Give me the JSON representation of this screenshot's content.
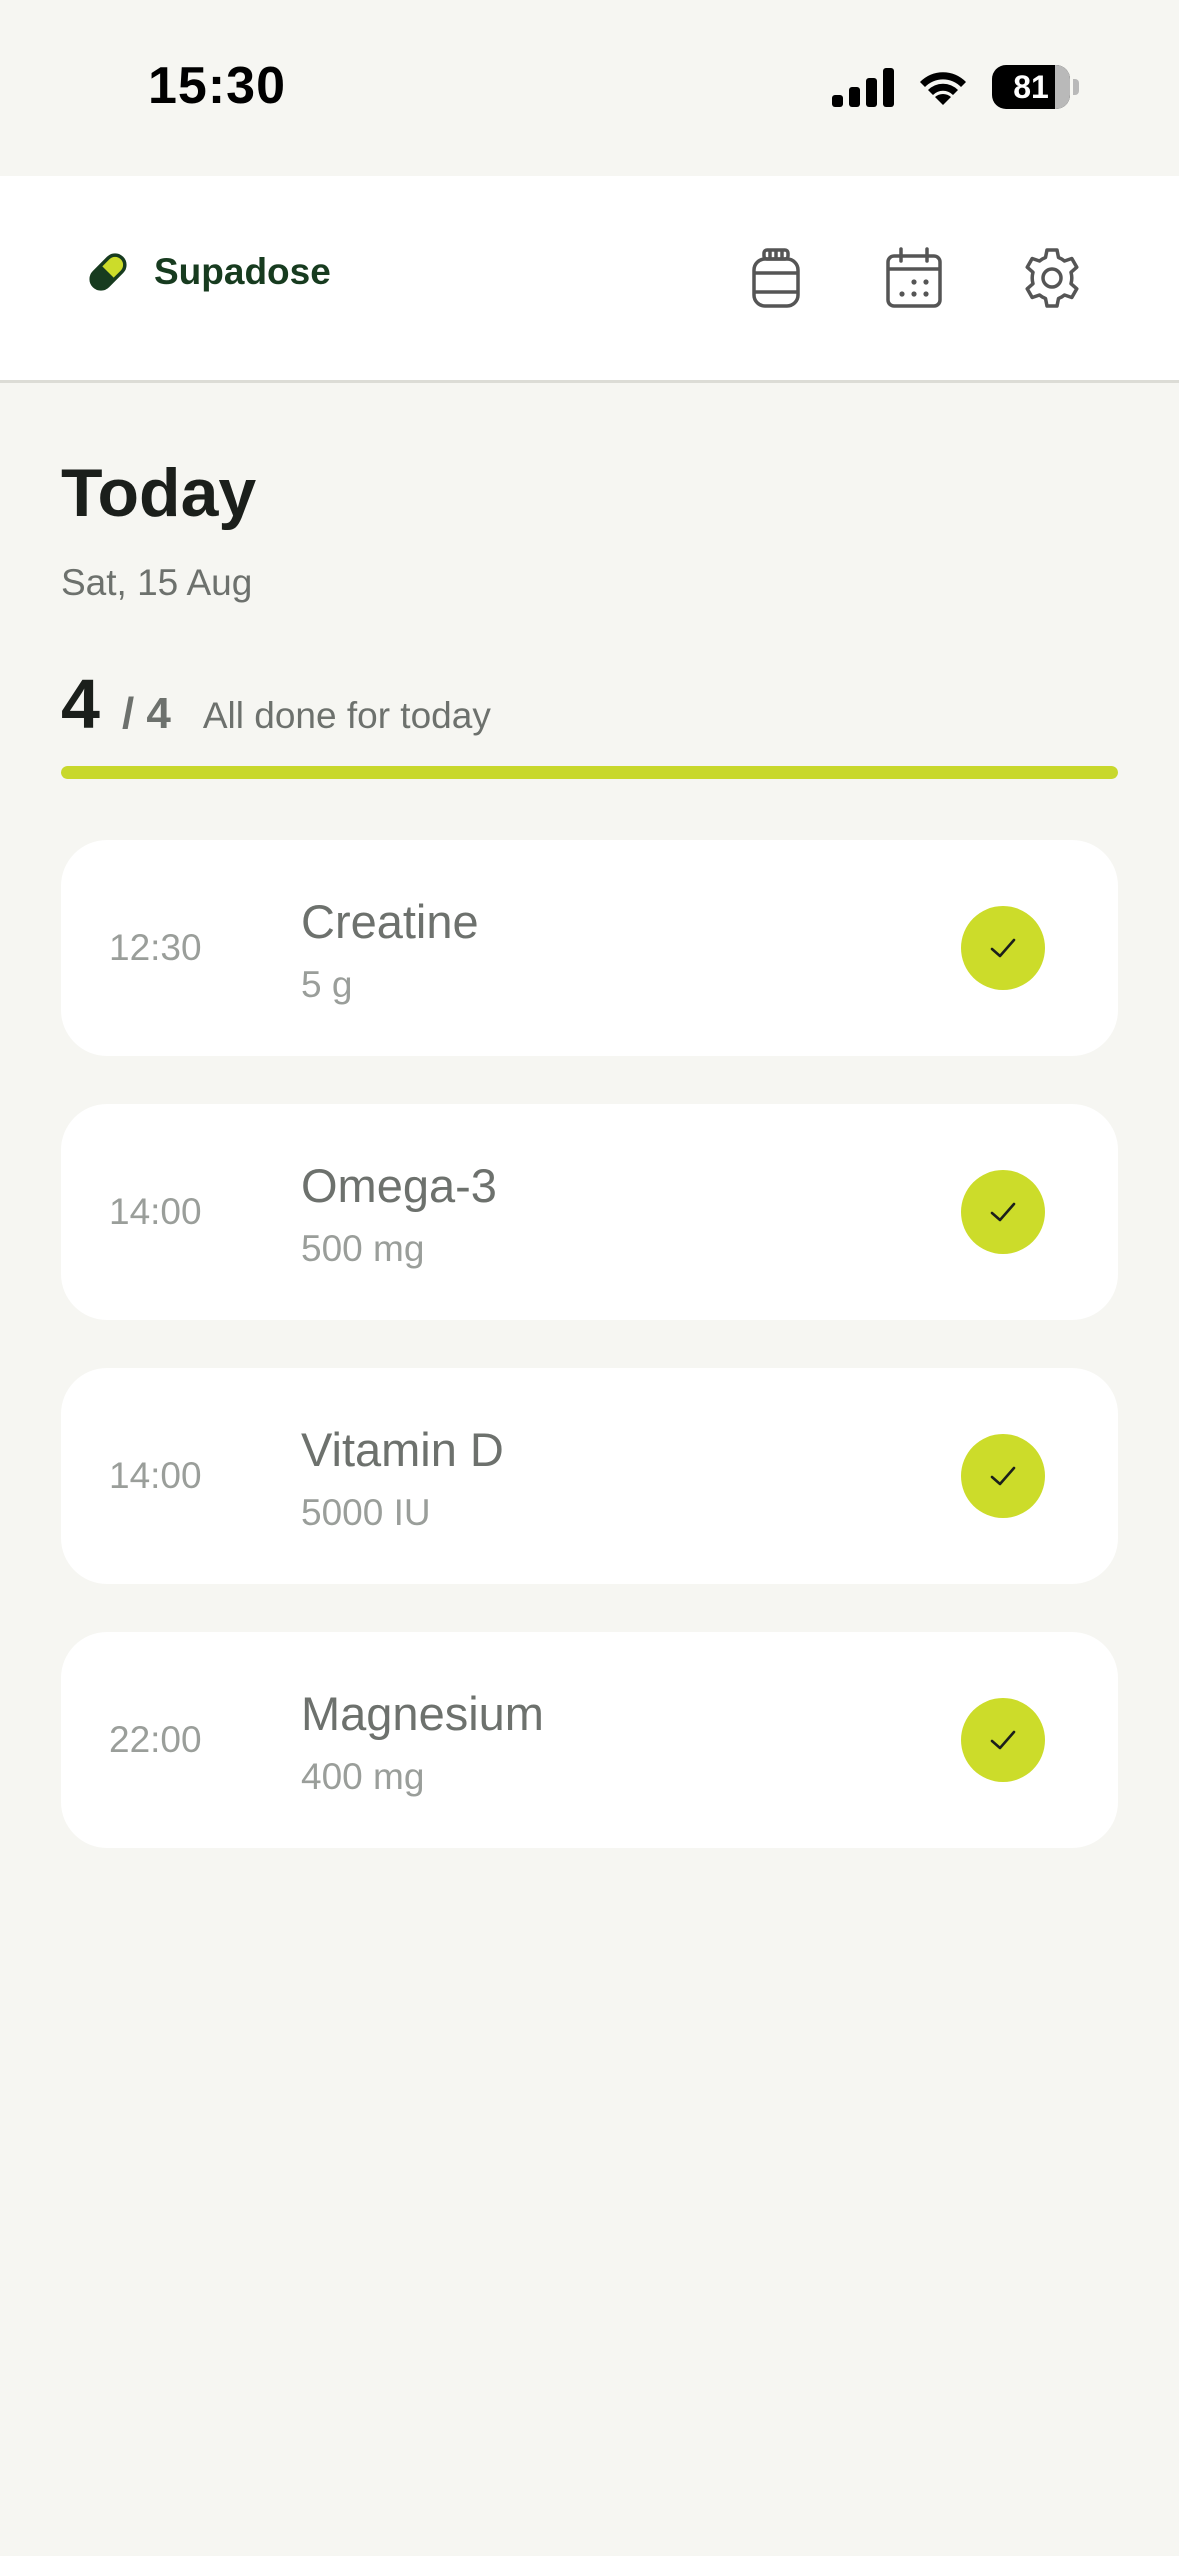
{
  "status_bar": {
    "time": "15:30",
    "battery": "81",
    "icons": [
      "cellular-signal-icon",
      "wifi-icon",
      "battery-icon"
    ]
  },
  "header": {
    "app_name": "Supadose",
    "brand_icon": "pill-icon",
    "actions": [
      {
        "name": "supplements",
        "icon": "jar-icon"
      },
      {
        "name": "calendar",
        "icon": "calendar-icon"
      },
      {
        "name": "settings",
        "icon": "gear-icon"
      }
    ]
  },
  "today": {
    "title": "Today",
    "date": "Sat, 15 Aug",
    "progress": {
      "done": "4",
      "total": "/ 4",
      "status": "All done for today",
      "fraction": 1.0
    }
  },
  "doses": [
    {
      "time": "12:30",
      "name": "Creatine",
      "amount": "5 g",
      "taken": true
    },
    {
      "time": "14:00",
      "name": "Omega-3",
      "amount": "500 mg",
      "taken": true
    },
    {
      "time": "14:00",
      "name": "Vitamin D",
      "amount": "5000 IU",
      "taken": true
    },
    {
      "time": "22:00",
      "name": "Magnesium",
      "amount": "400 mg",
      "taken": true
    }
  ],
  "colors": {
    "accent": "#ccdc2a",
    "brand_text": "#173b1f",
    "background": "#f6f6f2",
    "card": "#ffffff"
  }
}
